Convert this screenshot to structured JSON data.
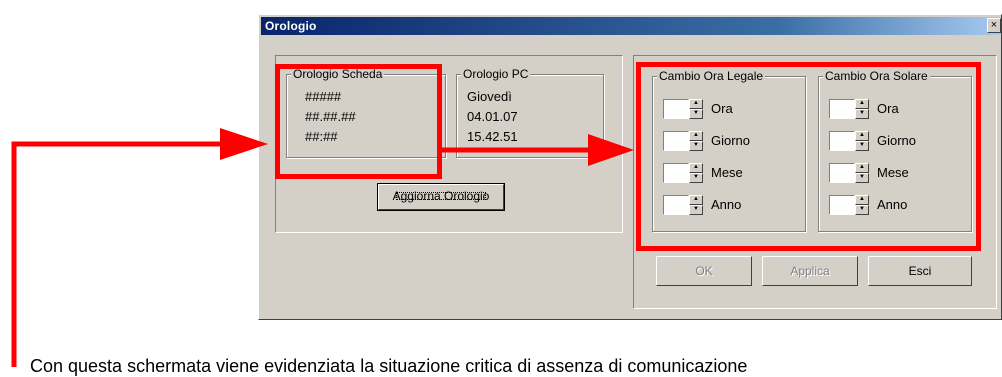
{
  "window": {
    "title": "Orologio",
    "close_glyph": "×"
  },
  "clock_board": {
    "label": "Orologio Scheda",
    "line1": "#####",
    "line2": "##.##.##",
    "line3": "##:##"
  },
  "clock_pc": {
    "label": "Orologio PC",
    "day": "Giovedì",
    "date": "04.01.07",
    "time": "15.42.51"
  },
  "update_button": "Aggiorna Orologio",
  "legal_time": {
    "label": "Cambio Ora Legale",
    "fields": [
      "Ora",
      "Giorno",
      "Mese",
      "Anno"
    ]
  },
  "solar_time": {
    "label": "Cambio Ora Solare",
    "fields": [
      "Ora",
      "Giorno",
      "Mese",
      "Anno"
    ]
  },
  "buttons": {
    "ok": "OK",
    "apply": "Applica",
    "exit": "Esci"
  },
  "caption": "Con questa schermata viene evidenziata la situazione critica di assenza di comunicazione",
  "annotation_color": "#ff0000"
}
